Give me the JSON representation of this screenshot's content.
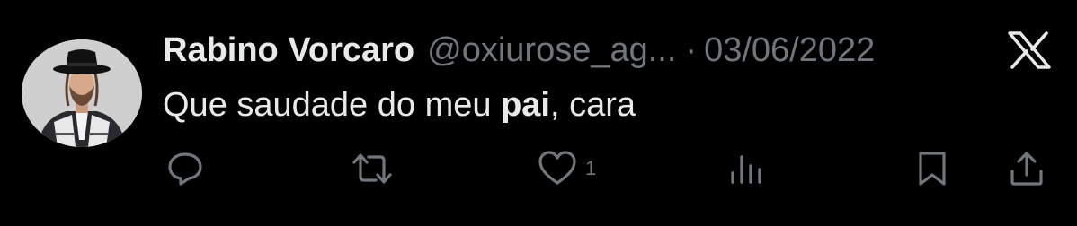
{
  "tweet": {
    "display_name": "Rabino Vorcaro",
    "handle": "@oxiurose_ag...",
    "separator": "·",
    "date": "03/06/2022",
    "text_before": "Que saudade do meu ",
    "text_bold": "pai",
    "text_after": ", cara"
  },
  "platform_logo": "x-logo",
  "actions": {
    "reply_icon": "speech-bubble",
    "retweet_icon": "retweet-arrows",
    "like_icon": "heart",
    "like_count": "1",
    "views_icon": "bar-chart",
    "bookmark_icon": "bookmark",
    "share_icon": "share-upload"
  },
  "colors": {
    "background": "#000000",
    "primary_text": "#e7e9ea",
    "secondary_text": "#71767b"
  }
}
